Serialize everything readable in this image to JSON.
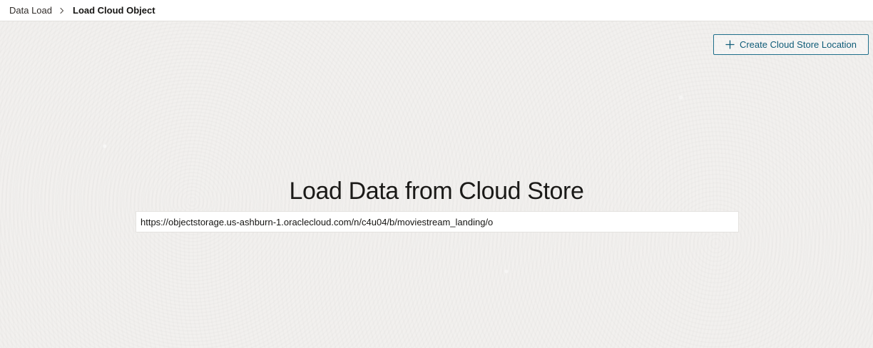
{
  "breadcrumb": {
    "parent": "Data Load",
    "current": "Load Cloud Object"
  },
  "toolbar": {
    "create_location_label": "Create Cloud Store Location"
  },
  "main": {
    "title": "Load Data from Cloud Store",
    "url_value": "https://objectstorage.us-ashburn-1.oraclecloud.com/n/c4u04/b/moviestream_landing/o"
  },
  "icons": {
    "breadcrumb_separator": "chevron-right-icon",
    "create_button": "plus-icon"
  },
  "colors": {
    "accent": "#0f5c78",
    "background": "#f1efed",
    "input_background": "#ffffff"
  }
}
